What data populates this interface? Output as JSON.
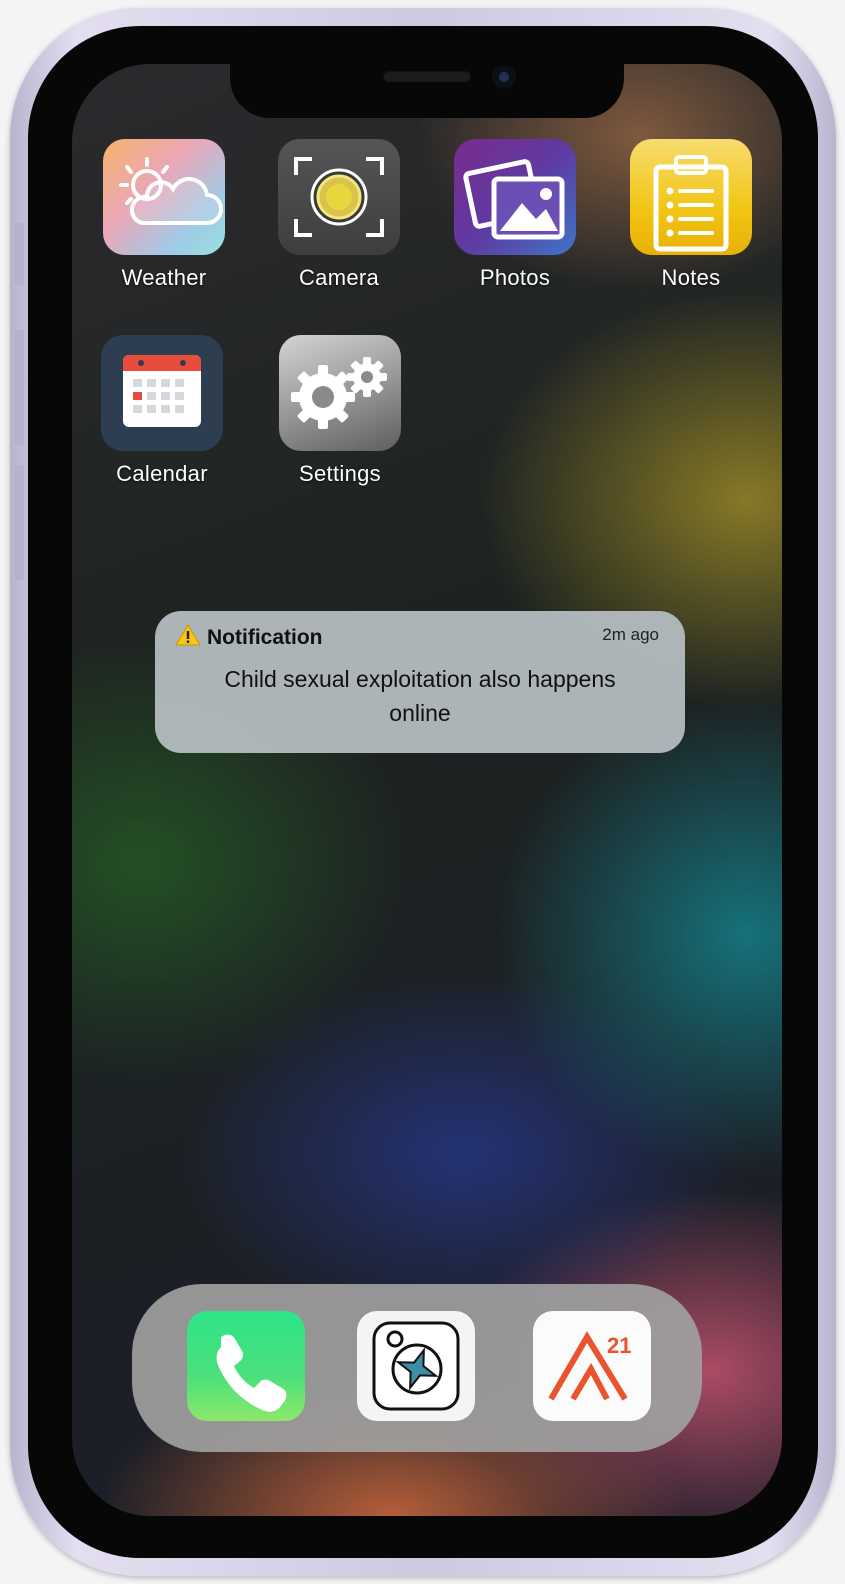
{
  "home": {
    "apps": [
      {
        "label": "Weather",
        "icon": "weather-icon"
      },
      {
        "label": "Camera",
        "icon": "camera-icon"
      },
      {
        "label": "Photos",
        "icon": "photos-icon"
      },
      {
        "label": "Notes",
        "icon": "notes-icon"
      },
      {
        "label": "Calendar",
        "icon": "calendar-icon"
      },
      {
        "label": "Settings",
        "icon": "settings-icon"
      }
    ]
  },
  "notification": {
    "icon": "warning-icon",
    "title": "Notification",
    "time": "2m ago",
    "message": "Child sexual exploitation also happens online"
  },
  "dock": {
    "apps": [
      {
        "icon": "phone-icon"
      },
      {
        "icon": "compass-app-icon"
      },
      {
        "icon": "a21-logo-icon",
        "logo_text": "21"
      }
    ]
  },
  "colors": {
    "frame": "#cfc9de",
    "notification_bg": "#b2babe",
    "dock_bg": "#a0a0a0",
    "a21_accent": "#e9532d",
    "phone_green": "#3ddc84"
  }
}
